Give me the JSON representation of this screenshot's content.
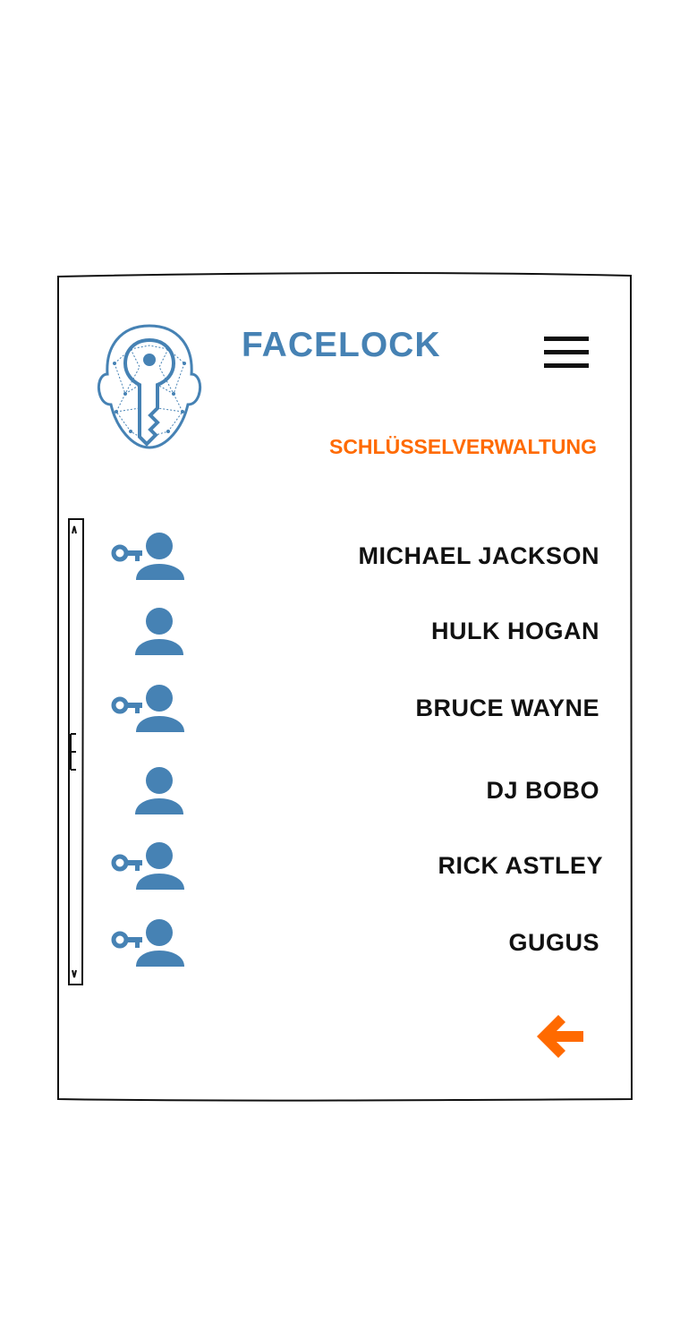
{
  "header": {
    "app_title": "FACELOCK",
    "subtitle": "SCHLÜSSELVERWALTUNG"
  },
  "users": [
    {
      "name": "MICHAEL JACKSON",
      "has_key": true
    },
    {
      "name": "HULK HOGAN",
      "has_key": false
    },
    {
      "name": "BRUCE WAYNE",
      "has_key": true
    },
    {
      "name": "DJ BOBO",
      "has_key": false
    },
    {
      "name": "RICK ASTLEY",
      "has_key": true
    },
    {
      "name": "GUGUS",
      "has_key": true
    }
  ],
  "colors": {
    "brand_blue": "#4682b4",
    "accent_orange": "#ff6a00",
    "text": "#111111"
  },
  "icons": {
    "logo": "face-key-logo-icon",
    "menu": "hamburger-menu-icon",
    "user_with_key": "key-user-icon",
    "user": "user-icon",
    "back": "arrow-left-icon"
  }
}
